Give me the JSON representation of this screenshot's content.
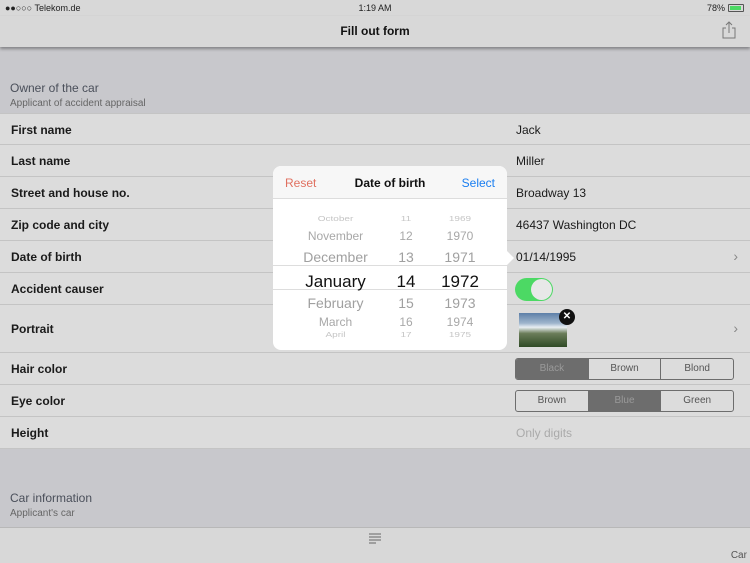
{
  "status": {
    "carrier": "●●○○○ Telekom.de",
    "wifi": "wifi-icon",
    "time": "1:19 AM",
    "battery": "78%"
  },
  "nav": {
    "title": "Fill out form"
  },
  "owner": {
    "title": "Owner of the car",
    "subtitle": "Applicant of accident appraisal"
  },
  "rows": {
    "first_name": {
      "label": "First name",
      "value": "Jack"
    },
    "last_name": {
      "label": "Last name",
      "value": "Miller"
    },
    "street": {
      "label": "Street and house no.",
      "value": "Broadway 13"
    },
    "zip": {
      "label": "Zip code and city",
      "value": "46437 Washington DC"
    },
    "dob": {
      "label": "Date of birth",
      "value": "01/14/1995"
    },
    "causer": {
      "label": "Accident causer",
      "on": true
    },
    "portrait": {
      "label": "Portrait"
    },
    "hair": {
      "label": "Hair color",
      "options": [
        "Black",
        "Brown",
        "Blond"
      ],
      "selected": "Black"
    },
    "eye": {
      "label": "Eye color",
      "options": [
        "Brown",
        "Blue",
        "Green"
      ],
      "selected": "Blue"
    },
    "height": {
      "label": "Height",
      "placeholder": "Only digits"
    }
  },
  "car": {
    "title": "Car information",
    "subtitle": "Applicant's car"
  },
  "tabbar": {
    "label": "Car data"
  },
  "picker": {
    "reset": "Reset",
    "title": "Date of birth",
    "select": "Select",
    "months": [
      "October",
      "November",
      "December",
      "January",
      "February",
      "March",
      "April"
    ],
    "days": [
      "11",
      "12",
      "13",
      "14",
      "15",
      "16",
      "17"
    ],
    "years": [
      "1969",
      "1970",
      "1971",
      "1972",
      "1973",
      "1974",
      "1975"
    ],
    "selected_index": 3
  }
}
